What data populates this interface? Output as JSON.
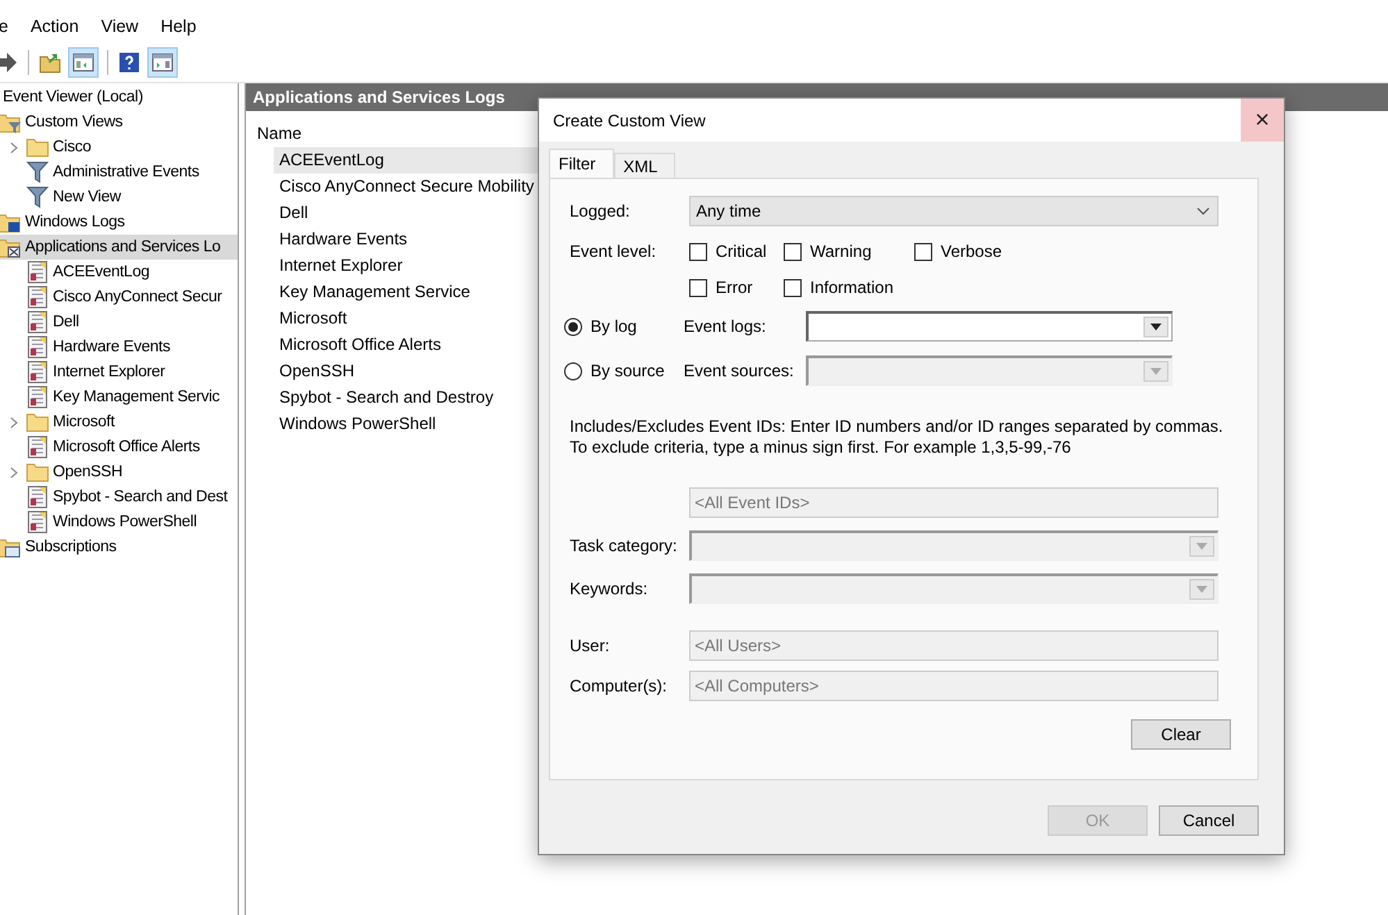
{
  "menu": [
    "e",
    "Action",
    "View",
    "Help"
  ],
  "toolbar": [
    {
      "kind": "forward",
      "pressed": false
    },
    {
      "kind": "separator"
    },
    {
      "kind": "folder-up",
      "pressed": false
    },
    {
      "kind": "show-pane",
      "pressed": true
    },
    {
      "kind": "separator"
    },
    {
      "kind": "help",
      "pressed": false
    },
    {
      "kind": "action-pane",
      "pressed": true
    }
  ],
  "tree": {
    "label": "Event Viewer (Local)",
    "selected": false,
    "children": [
      {
        "label": "Custom Views",
        "kind": "filter-folder",
        "selected": false,
        "children": [
          {
            "label": "Cisco",
            "kind": "folder",
            "selected": false,
            "expanded": false
          },
          {
            "label": "Administrative Events",
            "kind": "filter",
            "selected": false
          },
          {
            "label": "New View",
            "kind": "filter",
            "selected": false
          }
        ]
      },
      {
        "label": "Windows Logs",
        "kind": "windows-folder",
        "selected": false
      },
      {
        "label": "Applications and Services Lo",
        "kind": "apps-folder",
        "selected": true,
        "children": [
          {
            "label": "ACEEventLog",
            "kind": "log",
            "selected": false
          },
          {
            "label": "Cisco AnyConnect Secur",
            "kind": "log",
            "selected": false
          },
          {
            "label": "Dell",
            "kind": "log",
            "selected": false
          },
          {
            "label": "Hardware Events",
            "kind": "log",
            "selected": false
          },
          {
            "label": "Internet Explorer",
            "kind": "log",
            "selected": false
          },
          {
            "label": "Key Management Servic",
            "kind": "log",
            "selected": false
          },
          {
            "label": "Microsoft",
            "kind": "folder",
            "selected": false,
            "expanded": false
          },
          {
            "label": "Microsoft Office Alerts",
            "kind": "log",
            "selected": false
          },
          {
            "label": "OpenSSH",
            "kind": "folder",
            "selected": false,
            "expanded": false
          },
          {
            "label": "Spybot - Search and Dest",
            "kind": "log",
            "selected": false
          },
          {
            "label": "Windows PowerShell",
            "kind": "log",
            "selected": false
          }
        ]
      },
      {
        "label": "Subscriptions",
        "kind": "subscriptions",
        "selected": false
      }
    ]
  },
  "list": {
    "title": "Applications and Services Logs",
    "column": "Name",
    "rows": [
      {
        "name": "ACEEventLog",
        "selected": true
      },
      {
        "name": "Cisco AnyConnect Secure Mobility",
        "selected": false
      },
      {
        "name": "Dell",
        "selected": false
      },
      {
        "name": "Hardware Events",
        "selected": false
      },
      {
        "name": "Internet Explorer",
        "selected": false
      },
      {
        "name": "Key Management Service",
        "selected": false
      },
      {
        "name": "Microsoft",
        "selected": false
      },
      {
        "name": "Microsoft Office Alerts",
        "selected": false
      },
      {
        "name": "OpenSSH",
        "selected": false
      },
      {
        "name": "Spybot - Search and Destroy",
        "selected": false
      },
      {
        "name": "Windows PowerShell",
        "selected": false
      }
    ]
  },
  "dialog": {
    "title": "Create Custom View",
    "close": "×",
    "tabs": [
      {
        "label": "Filter",
        "selected": true
      },
      {
        "label": "XML",
        "selected": false
      }
    ],
    "logged": {
      "label": "Logged:",
      "value": "Any time"
    },
    "event_level": {
      "label": "Event level:",
      "options": [
        {
          "label": "Critical",
          "checked": false
        },
        {
          "label": "Warning",
          "checked": false
        },
        {
          "label": "Verbose",
          "checked": false
        },
        {
          "label": "Error",
          "checked": false
        },
        {
          "label": "Information",
          "checked": false
        }
      ]
    },
    "scope": [
      {
        "label": "By log",
        "selected": true,
        "field_label": "Event logs:",
        "disabled": false
      },
      {
        "label": "By source",
        "selected": false,
        "field_label": "Event sources:",
        "disabled": true
      }
    ],
    "ids_help": "Includes/Excludes Event IDs: Enter ID numbers and/or ID ranges separated by commas. To exclude criteria, type a minus sign first. For example 1,3,5-99,-76",
    "event_ids": {
      "placeholder": "<All Event IDs>"
    },
    "task_category": {
      "label": "Task category:",
      "disabled": true
    },
    "keywords": {
      "label": "Keywords:",
      "disabled": true
    },
    "user": {
      "label": "User:",
      "placeholder": "<All Users>"
    },
    "computers": {
      "label": "Computer(s):",
      "placeholder": "<All Computers>"
    },
    "clear_button": "Clear",
    "buttons": [
      {
        "label": "OK",
        "disabled": true
      },
      {
        "label": "Cancel",
        "disabled": false
      }
    ]
  }
}
